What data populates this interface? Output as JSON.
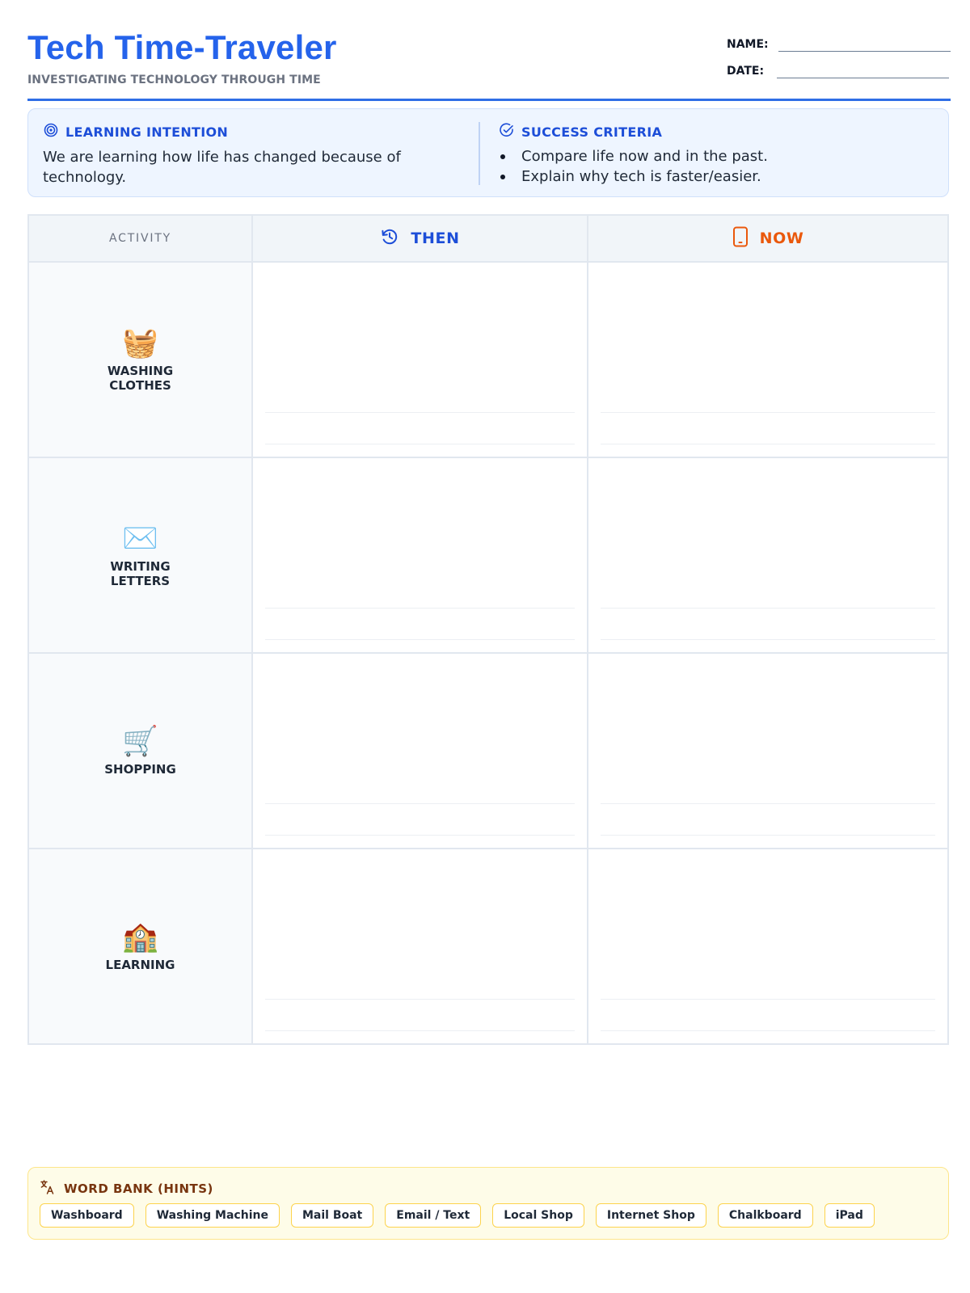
{
  "header": {
    "title": "Tech Time-Traveler",
    "subtitle": "INVESTIGATING TECHNOLOGY THROUGH TIME",
    "name_label": "NAME:",
    "date_label": "DATE:"
  },
  "learning_intention": {
    "heading": "LEARNING INTENTION",
    "text": "We are learning how life has changed because of technology.",
    "icon": "target-icon"
  },
  "success_criteria": {
    "heading": "SUCCESS CRITERIA",
    "items": [
      "Compare life now and in the past.",
      "Explain why tech is faster/easier."
    ],
    "icon": "check-circle-icon"
  },
  "table": {
    "headers": {
      "activity": "ACTIVITY",
      "then": "THEN",
      "now": "NOW"
    },
    "rows": [
      {
        "label": "WASHING CLOTHES",
        "icon": "🧺"
      },
      {
        "label": "WRITING LETTERS",
        "icon": "✉️"
      },
      {
        "label": "SHOPPING",
        "icon": "🛒"
      },
      {
        "label": "LEARNING",
        "icon": "🏫"
      }
    ]
  },
  "word_bank": {
    "heading": "WORD BANK (HINTS)",
    "words": [
      "Washboard",
      "Washing Machine",
      "Mail Boat",
      "Email / Text",
      "Local Shop",
      "Internet Shop",
      "Chalkboard",
      "iPad"
    ]
  },
  "colors": {
    "accent_blue": "#2563eb",
    "now_orange": "#ea580c",
    "intent_bg": "#eef5ff",
    "wordbank_bg": "#fefce8"
  }
}
